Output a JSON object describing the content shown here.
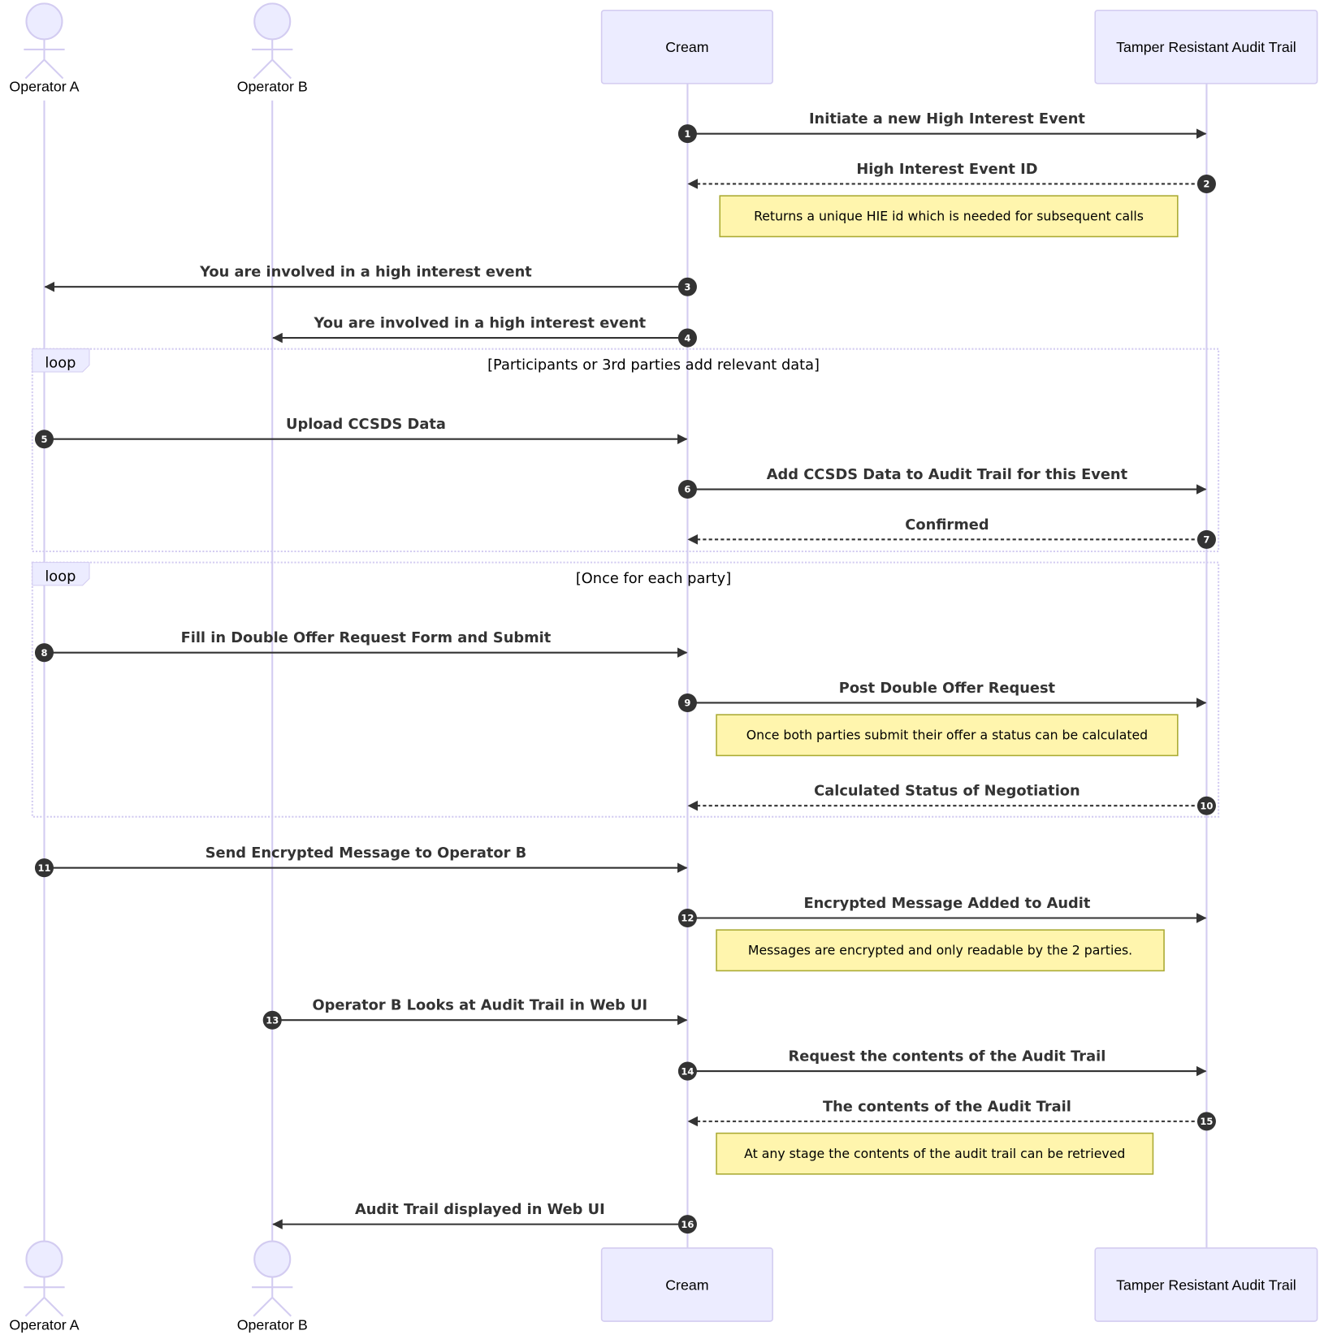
{
  "colors": {
    "actor_fill": "#ECECFF",
    "actor_stroke": "#D3CCF1",
    "lifeline": "#D3CCF1",
    "message_line": "#333333",
    "note_fill": "#FFF5AD",
    "note_stroke": "#AAAA33",
    "loop_stroke": "#D3CCF1",
    "loop_label_fill": "#ECECFF",
    "sequence_badge": "#333333"
  },
  "participants": [
    {
      "id": "A",
      "label": "Operator A",
      "type": "actor"
    },
    {
      "id": "B",
      "label": "Operator B",
      "type": "actor"
    },
    {
      "id": "C",
      "label": "Cream",
      "type": "participant"
    },
    {
      "id": "T",
      "label": "Tamper Resistant Audit Trail",
      "type": "participant"
    }
  ],
  "messages": [
    {
      "num": "1",
      "from": "C",
      "to": "T",
      "text": "Initiate a new High Interest Event",
      "dashed": false
    },
    {
      "num": "2",
      "from": "T",
      "to": "C",
      "text": "High Interest Event ID",
      "dashed": true
    },
    {
      "num": "3",
      "from": "C",
      "to": "A",
      "text": "You are involved in a high interest event",
      "dashed": false
    },
    {
      "num": "4",
      "from": "C",
      "to": "B",
      "text": "You are involved in a high interest event",
      "dashed": false
    },
    {
      "num": "5",
      "from": "A",
      "to": "C",
      "text": "Upload CCSDS Data",
      "dashed": false
    },
    {
      "num": "6",
      "from": "C",
      "to": "T",
      "text": "Add CCSDS Data to Audit Trail for this Event",
      "dashed": false
    },
    {
      "num": "7",
      "from": "T",
      "to": "C",
      "text": "Confirmed",
      "dashed": true
    },
    {
      "num": "8",
      "from": "A",
      "to": "C",
      "text": "Fill in Double Offer Request Form and Submit",
      "dashed": false
    },
    {
      "num": "9",
      "from": "C",
      "to": "T",
      "text": "Post Double Offer Request",
      "dashed": false
    },
    {
      "num": "10",
      "from": "T",
      "to": "C",
      "text": "Calculated Status of Negotiation",
      "dashed": true
    },
    {
      "num": "11",
      "from": "A",
      "to": "C",
      "text": "Send Encrypted Message to Operator B",
      "dashed": false
    },
    {
      "num": "12",
      "from": "C",
      "to": "T",
      "text": "Encrypted Message Added to Audit",
      "dashed": false
    },
    {
      "num": "13",
      "from": "B",
      "to": "C",
      "text": "Operator B Looks at Audit Trail in Web UI",
      "dashed": false
    },
    {
      "num": "14",
      "from": "C",
      "to": "T",
      "text": "Request the contents of the Audit Trail",
      "dashed": false
    },
    {
      "num": "15",
      "from": "T",
      "to": "C",
      "text": "The contents of the Audit Trail",
      "dashed": true
    },
    {
      "num": "16",
      "from": "C",
      "to": "B",
      "text": "Audit Trail displayed in Web UI",
      "dashed": false
    }
  ],
  "notes": [
    {
      "after": "2",
      "text": "Returns a unique HIE id which is needed for subsequent calls"
    },
    {
      "after": "9",
      "text": "Once both parties submit their offer a status can be calculated"
    },
    {
      "after": "12",
      "text": "Messages are encrypted and only readable by the 2 parties."
    },
    {
      "after": "15",
      "text": "At any stage the contents of the audit trail can be retrieved"
    }
  ],
  "loops": [
    {
      "label": "loop",
      "condition": "[Participants or 3rd parties add relevant data]",
      "first": "5",
      "last": "7"
    },
    {
      "label": "loop",
      "condition": "[Once for each party]",
      "first": "8",
      "last": "10"
    }
  ]
}
